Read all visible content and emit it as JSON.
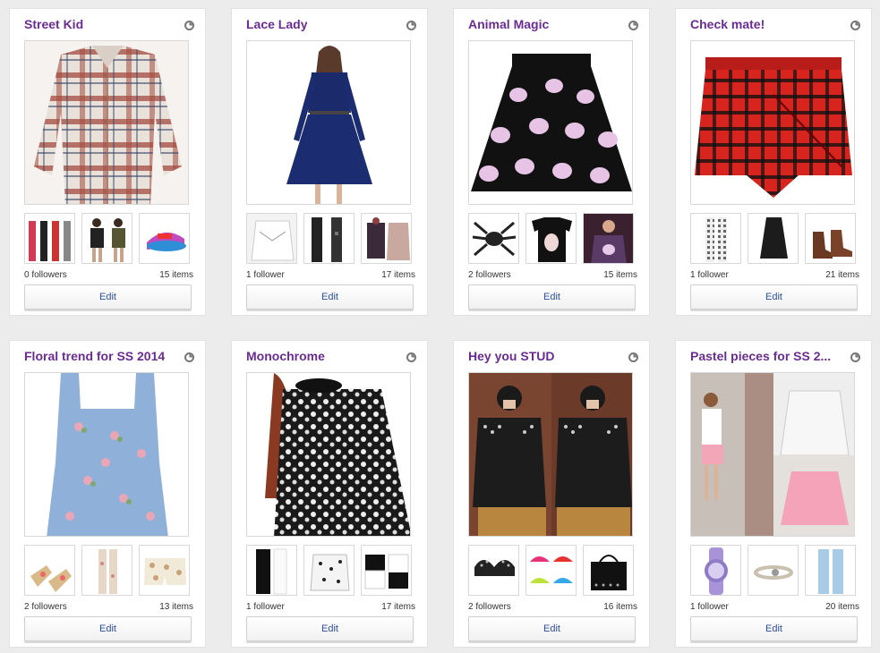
{
  "boards": [
    {
      "title": "Street Kid",
      "followers": "0 followers",
      "items": "15 items",
      "edit_label": "Edit",
      "main_image": "plaid-shirt",
      "thumbs": [
        "leggings",
        "graphic-tees",
        "snapback-cap"
      ]
    },
    {
      "title": "Lace Lady",
      "followers": "1 follower",
      "items": "17 items",
      "edit_label": "Edit",
      "main_image": "navy-lace-dress",
      "thumbs": [
        "white-lace-blouse",
        "lace-tights",
        "lace-tops"
      ]
    },
    {
      "title": "Animal Magic",
      "followers": "2 followers",
      "items": "15 items",
      "edit_label": "Edit",
      "main_image": "cat-print-skirt",
      "thumbs": [
        "spider-ring",
        "cat-tee",
        "cat-sweater"
      ]
    },
    {
      "title": "Check mate!",
      "followers": "1 follower",
      "items": "21 items",
      "edit_label": "Edit",
      "main_image": "red-tartan-skort",
      "thumbs": [
        "check-trousers",
        "black-slip-dress",
        "brown-boots"
      ]
    },
    {
      "title": "Floral trend for SS 2014",
      "followers": "2 followers",
      "items": "13 items",
      "edit_label": "Edit",
      "main_image": "floral-dungarees",
      "thumbs": [
        "floral-sandals",
        "floral-jeans",
        "floral-shorts"
      ]
    },
    {
      "title": "Monochrome",
      "followers": "1 follower",
      "items": "17 items",
      "edit_label": "Edit",
      "main_image": "monochrome-print-dress",
      "thumbs": [
        "white-trousers",
        "print-sweater",
        "colorblock-tops"
      ]
    },
    {
      "title": "Hey you STUD",
      "followers": "2 followers",
      "items": "16 items",
      "edit_label": "Edit",
      "main_image": "studded-leather-jackets",
      "thumbs": [
        "studded-bra",
        "neon-bras",
        "studded-bag"
      ]
    },
    {
      "title": "Pastel pieces for SS 2...",
      "followers": "1 follower",
      "items": "20 items",
      "edit_label": "Edit",
      "main_image": "pastel-outfits",
      "thumbs": [
        "lilac-watch",
        "rope-bracelet",
        "pastel-jeans"
      ]
    }
  ],
  "colors": {
    "title": "#6a2c93",
    "edit_text": "#2b4f9a",
    "background": "#ececec"
  },
  "icons": {
    "share": "share-icon"
  }
}
